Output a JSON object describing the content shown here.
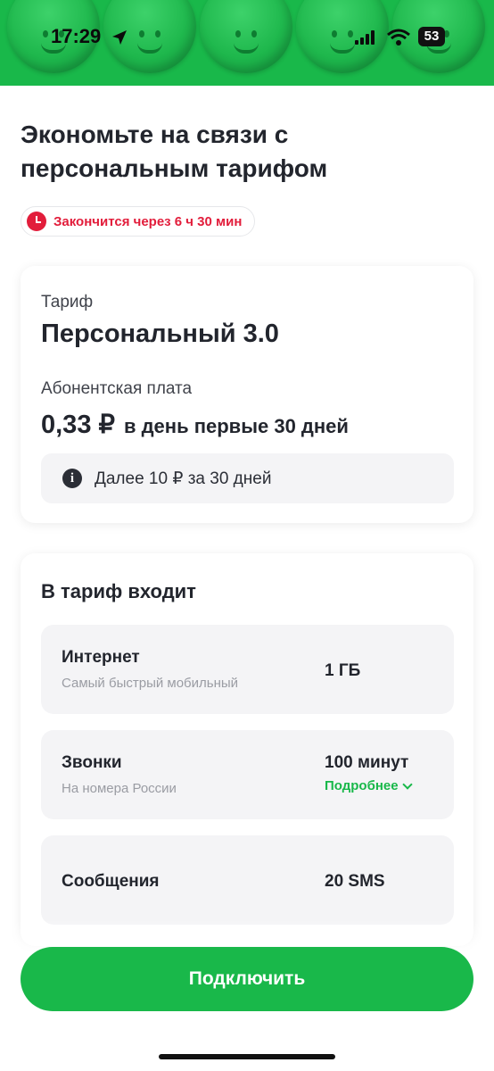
{
  "status_bar": {
    "time": "17:29",
    "battery": "53",
    "icons": [
      "location-arrow-icon",
      "cellular-signal-icon",
      "wifi-icon",
      "battery-icon"
    ]
  },
  "headline": "Экономьте на связи с персональным тарифом",
  "timer": {
    "text": "Закончится через 6 ч 30 мин",
    "icon": "clock-icon"
  },
  "tariff_card": {
    "tariff_label": "Тариф",
    "tariff_name": "Персональный 3.0",
    "fee_label": "Абонентская плата",
    "price": "0,33 ₽",
    "price_period": "в день первые 30 дней",
    "info_icon": "i",
    "info_text": "Далее 10 ₽ за 30 дней"
  },
  "included": {
    "title": "В тариф входит",
    "items": [
      {
        "name": "Интернет",
        "sub": "Самый быстрый мобильный",
        "value": "1 ГБ"
      },
      {
        "name": "Звонки",
        "sub": "На номера России",
        "value": "100 минут",
        "more": "Подробнее"
      },
      {
        "name": "Сообщения",
        "value": "20 SMS"
      }
    ]
  },
  "cta_label": "Подключить",
  "colors": {
    "brand_green": "#19b84a",
    "accent_red": "#e21d3b",
    "text_dark": "#22252d",
    "muted": "#9a9ca3",
    "surface": "#f4f4f6"
  }
}
